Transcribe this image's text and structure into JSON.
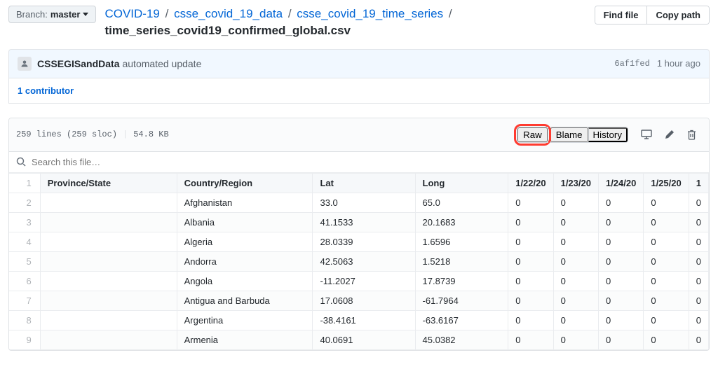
{
  "branch": {
    "label": "Branch:",
    "name": "master"
  },
  "breadcrumb": {
    "root": "COVID-19",
    "parts": [
      "csse_covid_19_data",
      "csse_covid_19_time_series"
    ],
    "filename": "time_series_covid19_confirmed_global.csv"
  },
  "top_buttons": {
    "find": "Find file",
    "copy": "Copy path"
  },
  "commit": {
    "author": "CSSEGISandData",
    "message": "automated update",
    "sha": "6af1fed",
    "age": "1 hour ago"
  },
  "contributors": {
    "text": "1 contributor"
  },
  "file_info": {
    "lines": "259 lines (259 sloc)",
    "size": "54.8 KB"
  },
  "actions": {
    "raw": "Raw",
    "blame": "Blame",
    "history": "History"
  },
  "search": {
    "placeholder": "Search this file…"
  },
  "table": {
    "headers": [
      "Province/State",
      "Country/Region",
      "Lat",
      "Long",
      "1/22/20",
      "1/23/20",
      "1/24/20",
      "1/25/20",
      "1"
    ],
    "rows": [
      {
        "n": "2",
        "cells": [
          "",
          "Afghanistan",
          "33.0",
          "65.0",
          "0",
          "0",
          "0",
          "0",
          "0"
        ]
      },
      {
        "n": "3",
        "cells": [
          "",
          "Albania",
          "41.1533",
          "20.1683",
          "0",
          "0",
          "0",
          "0",
          "0"
        ]
      },
      {
        "n": "4",
        "cells": [
          "",
          "Algeria",
          "28.0339",
          "1.6596",
          "0",
          "0",
          "0",
          "0",
          "0"
        ]
      },
      {
        "n": "5",
        "cells": [
          "",
          "Andorra",
          "42.5063",
          "1.5218",
          "0",
          "0",
          "0",
          "0",
          "0"
        ]
      },
      {
        "n": "6",
        "cells": [
          "",
          "Angola",
          "-11.2027",
          "17.8739",
          "0",
          "0",
          "0",
          "0",
          "0"
        ]
      },
      {
        "n": "7",
        "cells": [
          "",
          "Antigua and Barbuda",
          "17.0608",
          "-61.7964",
          "0",
          "0",
          "0",
          "0",
          "0"
        ]
      },
      {
        "n": "8",
        "cells": [
          "",
          "Argentina",
          "-38.4161",
          "-63.6167",
          "0",
          "0",
          "0",
          "0",
          "0"
        ]
      },
      {
        "n": "9",
        "cells": [
          "",
          "Armenia",
          "40.0691",
          "45.0382",
          "0",
          "0",
          "0",
          "0",
          "0"
        ]
      }
    ]
  }
}
